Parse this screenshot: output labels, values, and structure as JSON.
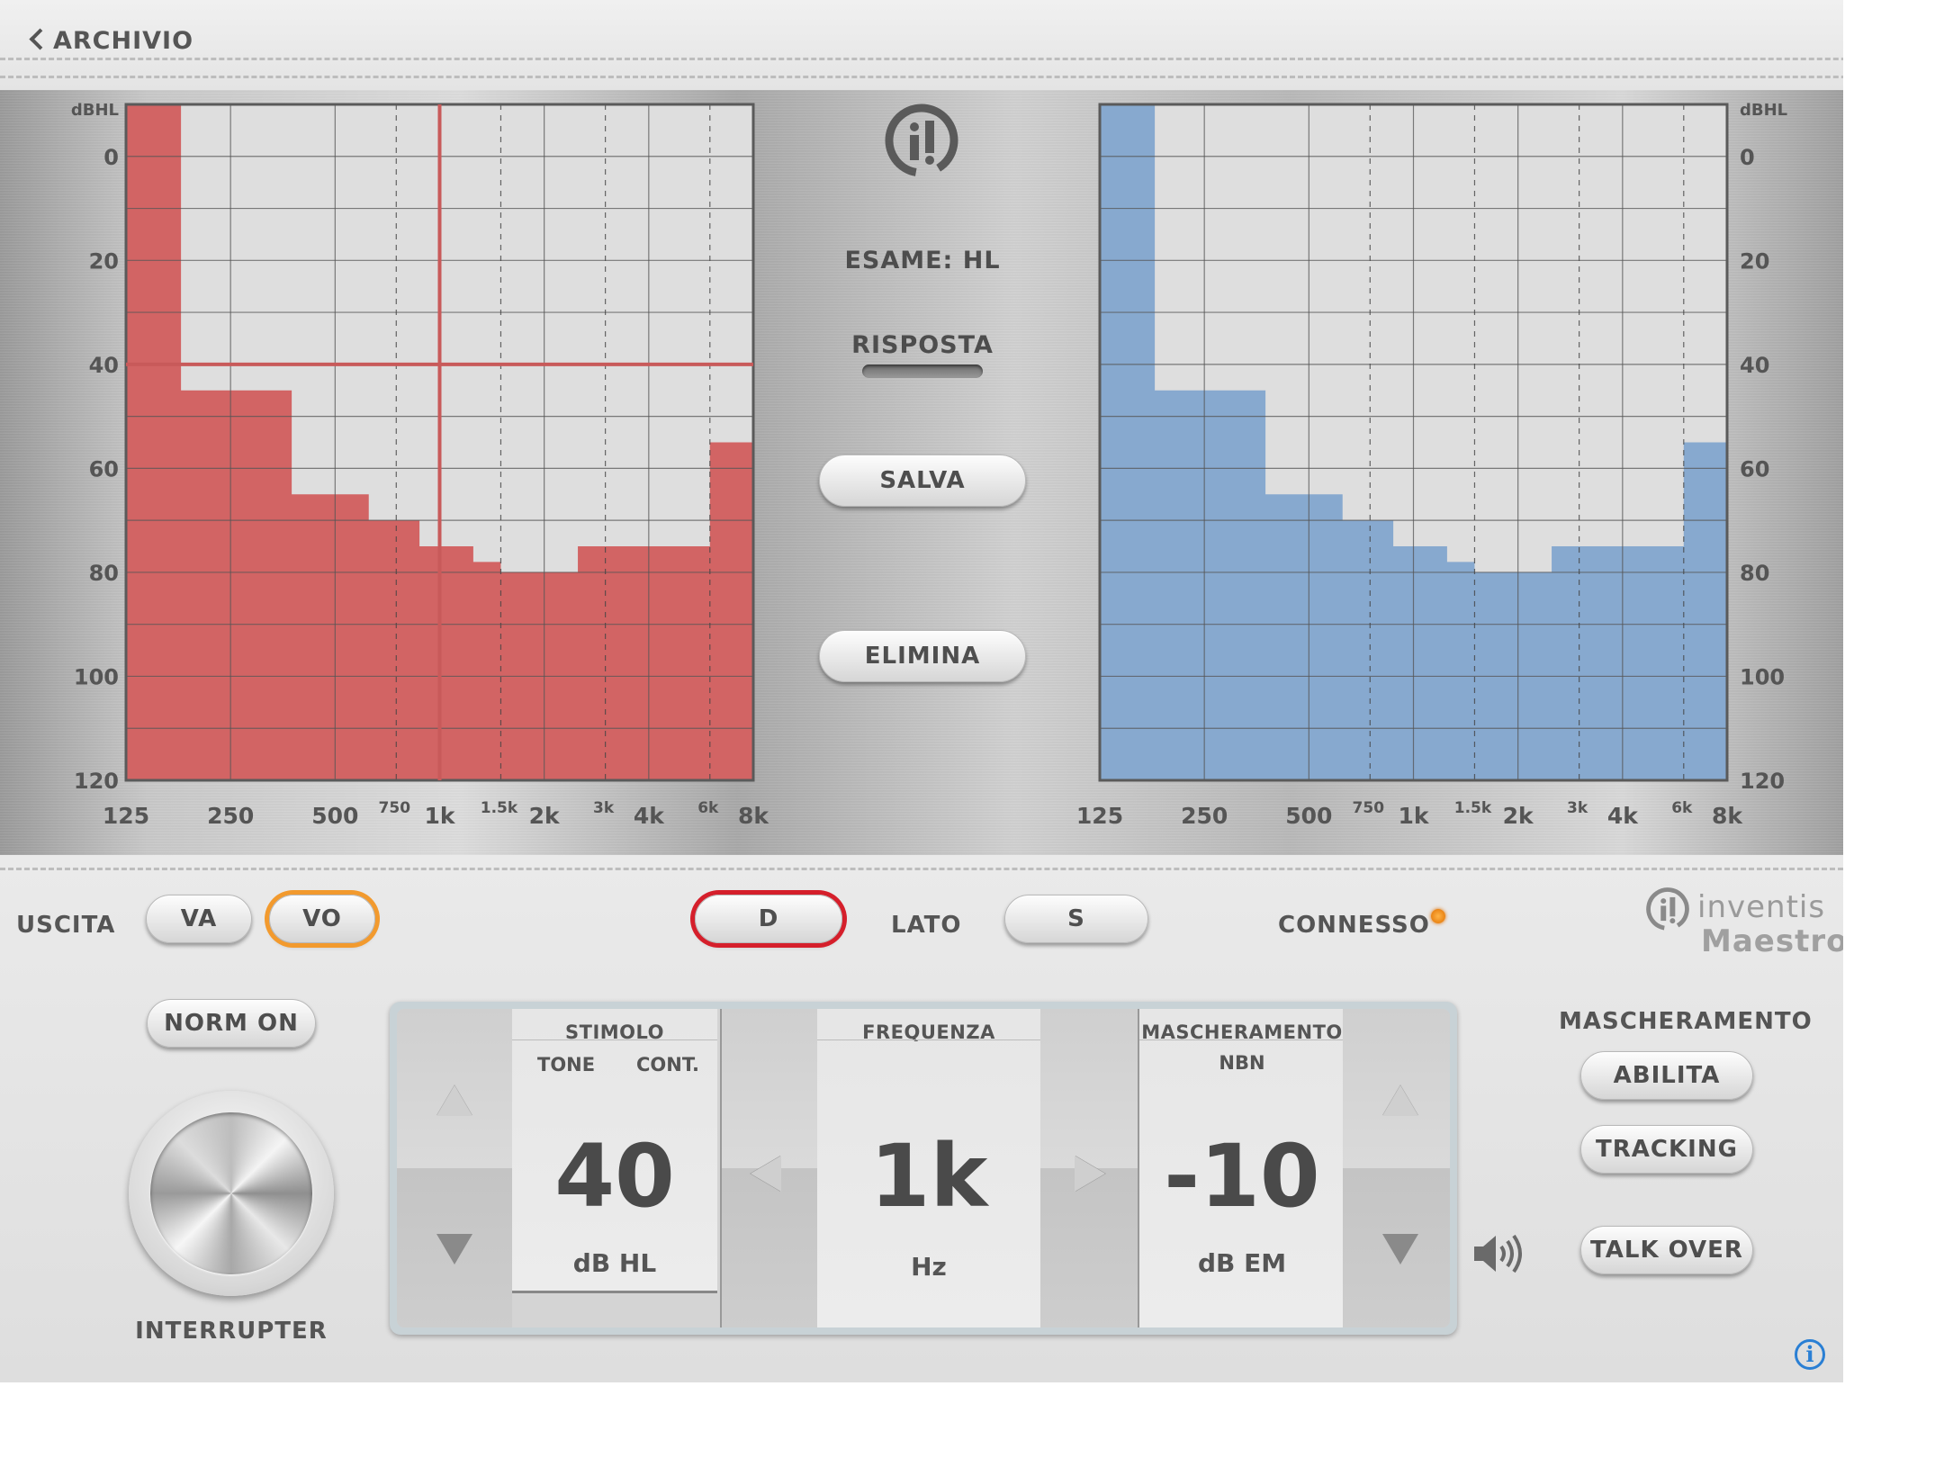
{
  "nav": {
    "back_label": "ARCHIVIO"
  },
  "audiogram": {
    "y_unit": "dBHL",
    "y_ticks": [
      "0",
      "20",
      "40",
      "60",
      "80",
      "100",
      "120"
    ],
    "x_ticks": [
      "125",
      "250",
      "500",
      "1k",
      "2k",
      "4k",
      "8k"
    ],
    "x_minor_ticks": [
      "750",
      "1.5k",
      "3k",
      "6k"
    ],
    "cursor": {
      "frequency": "1k",
      "level": 40
    }
  },
  "chart_data": [
    {
      "type": "area",
      "title": "",
      "side": "right-ear",
      "color": "#d26464",
      "xlabel": "",
      "ylabel": "dBHL",
      "ylim": [
        120,
        -10
      ],
      "x": [
        125,
        180,
        250,
        375,
        500,
        625,
        750,
        875,
        1000,
        1250,
        1500,
        1750,
        2000,
        2500,
        3000,
        4000,
        5000,
        6000,
        8000
      ],
      "values": [
        -10,
        45,
        45,
        65,
        65,
        70,
        70,
        75,
        75,
        78,
        80,
        80,
        80,
        75,
        75,
        75,
        75,
        55,
        50
      ]
    },
    {
      "type": "area",
      "title": "",
      "side": "left-ear",
      "color": "#87a9cf",
      "xlabel": "",
      "ylabel": "dBHL",
      "ylim": [
        120,
        -10
      ],
      "x": [
        125,
        180,
        250,
        375,
        500,
        625,
        750,
        875,
        1000,
        1250,
        1500,
        1750,
        2000,
        2500,
        3000,
        4000,
        5000,
        6000,
        8000
      ],
      "values": [
        -10,
        45,
        45,
        65,
        65,
        70,
        70,
        75,
        75,
        78,
        80,
        80,
        80,
        75,
        75,
        75,
        75,
        55,
        50
      ]
    }
  ],
  "center": {
    "exam_label": "ESAME: HL",
    "response_label": "RISPOSTA",
    "save_label": "SALVA",
    "delete_label": "ELIMINA"
  },
  "output": {
    "label": "USCITA",
    "options": [
      "VA",
      "VO"
    ],
    "selected": "VO"
  },
  "side": {
    "label": "LATO",
    "right": "D",
    "left": "S",
    "selected": "D"
  },
  "status": {
    "label": "CONNESSO",
    "led_color": "#e07000"
  },
  "brand": {
    "name": "inventis",
    "product": "Maestro"
  },
  "norm_button": "NORM ON",
  "interrupter_label": "INTERRUPTER",
  "stimulus": {
    "header": "STIMOLO",
    "type": "TONE",
    "mode": "CONT.",
    "value": "40",
    "unit": "dB HL"
  },
  "frequency": {
    "header": "FREQUENZA",
    "value": "1k",
    "unit": "Hz"
  },
  "masking": {
    "header": "MASCHERAMENTO",
    "type": "NBN",
    "value": "-10",
    "unit": "dB EM"
  },
  "masking_panel": {
    "title": "MASCHERAMENTO",
    "enable": "ABILITA",
    "tracking": "TRACKING",
    "talk_over": "TALK OVER"
  },
  "info_symbol": "i"
}
